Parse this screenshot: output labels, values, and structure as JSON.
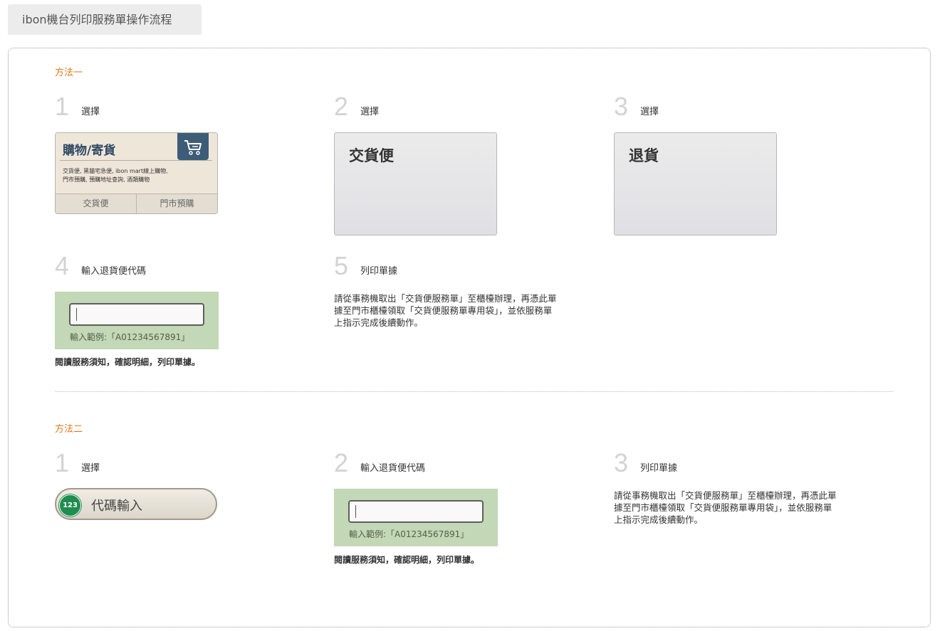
{
  "tab": {
    "title": "ibon機台列印服務單操作流程"
  },
  "method1": {
    "label": "方法一",
    "steps": [
      {
        "num": "1",
        "label": "選擇"
      },
      {
        "num": "2",
        "label": "選擇"
      },
      {
        "num": "3",
        "label": "選擇"
      },
      {
        "num": "4",
        "label": "輸入退貨便代碼"
      },
      {
        "num": "5",
        "label": "列印單據"
      }
    ],
    "shop_card": {
      "title": "購物/寄貨",
      "desc_line1": "交貨便, 黑貓宅急便, ibon mart線上購物,",
      "desc_line2": "門市預購, 預購地址查詢, 酒類購物",
      "btn1": "交貨便",
      "btn2": "門市預購"
    },
    "card2": "交貨便",
    "card3": "退貨",
    "code_hint": "輸入範例:「A01234567891」",
    "note": "閱讀服務須知，確認明細，列印單據。",
    "para_line1": "請從事務機取出「交貨便服務單」至櫃檯辦理，再憑此單",
    "para_line2": "據至門市櫃檯領取「交貨便服務單專用袋」，並依服務單",
    "para_line3": "上指示完成後續動作。"
  },
  "method2": {
    "label": "方法二",
    "steps": [
      {
        "num": "1",
        "label": "選擇"
      },
      {
        "num": "2",
        "label": "輸入退貨便代碼"
      },
      {
        "num": "3",
        "label": "列印單據"
      }
    ],
    "pill_badge": "123",
    "pill_text": "代碼輸入",
    "code_hint": "輸入範例:「A01234567891」",
    "note": "閱讀服務須知，確認明細，列印單據。",
    "para_line1": "請從事務機取出「交貨便服務單」至櫃檯辦理，再憑此單",
    "para_line2": "據至門市櫃檯領取「交貨便服務單專用袋」，並依服務單",
    "para_line3": "上指示完成後續動作。"
  }
}
